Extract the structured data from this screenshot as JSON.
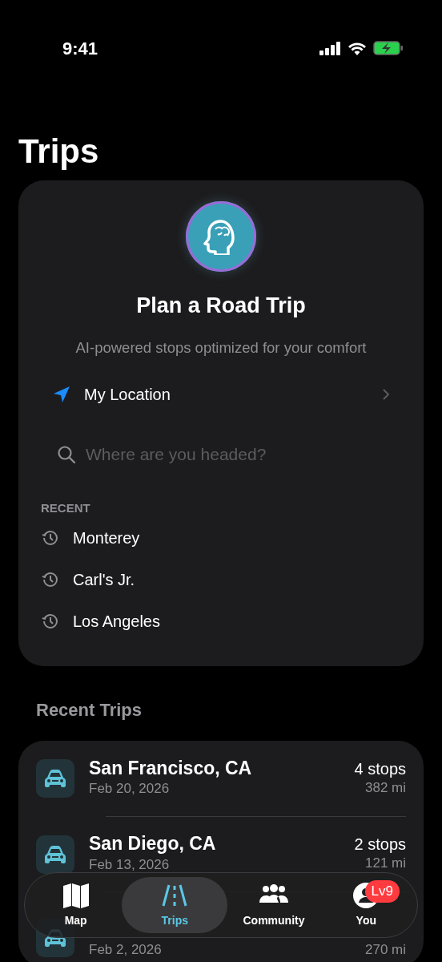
{
  "status_bar": {
    "time": "9:41"
  },
  "title": "Trips",
  "planner": {
    "heading": "Plan a Road Trip",
    "subtitle": "AI-powered stops optimized for your comfort",
    "origin": "My Location",
    "search": {
      "placeholder": "Where are you headed?"
    },
    "recent_label": "RECENT",
    "recent": [
      {
        "label": "Monterey"
      },
      {
        "label": "Carl's Jr."
      },
      {
        "label": "Los Angeles"
      }
    ]
  },
  "recent_trips": {
    "heading": "Recent Trips",
    "trips": [
      {
        "destination": "San Francisco, CA",
        "date": "Feb 20, 2026",
        "stops": "4 stops",
        "distance": "382 mi"
      },
      {
        "destination": "San Diego, CA",
        "date": "Feb 13, 2026",
        "stops": "2 stops",
        "distance": "121 mi"
      },
      {
        "date": "Feb 2, 2026",
        "distance": "270 mi"
      }
    ]
  },
  "tab_bar": [
    {
      "kind": "map",
      "label": "Map",
      "selected": false
    },
    {
      "kind": "road",
      "label": "Trips",
      "selected": true
    },
    {
      "kind": "people",
      "label": "Community",
      "selected": false
    },
    {
      "kind": "person",
      "label": "You",
      "selected": false,
      "badge": "Lv9"
    }
  ]
}
